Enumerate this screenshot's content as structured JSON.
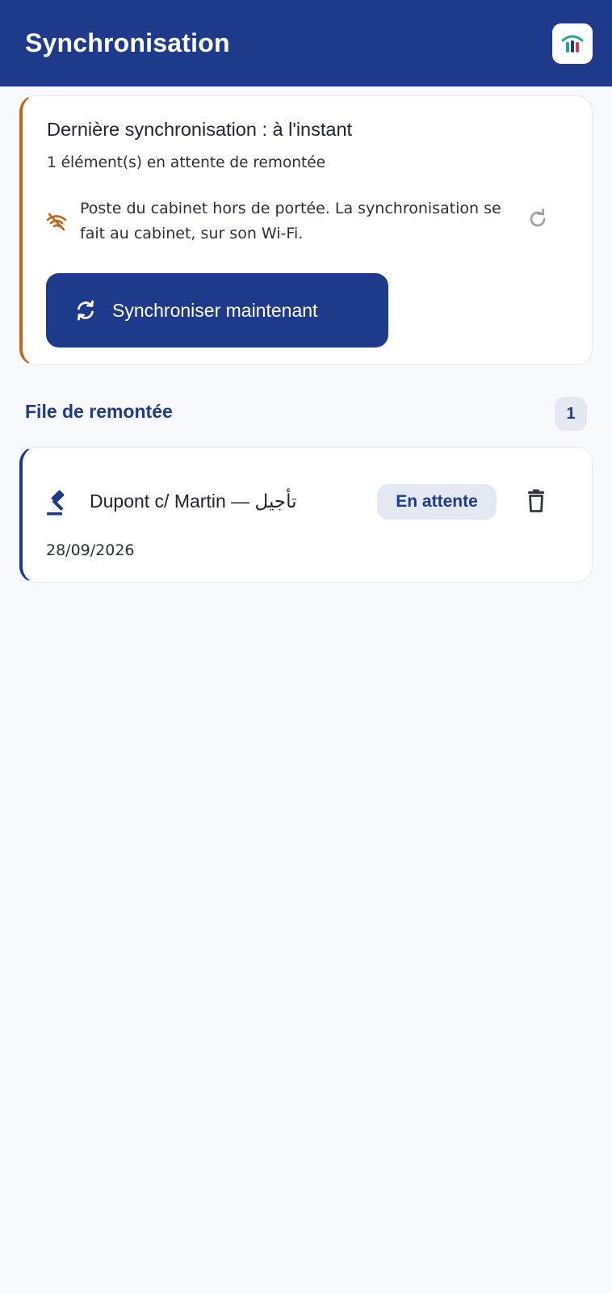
{
  "app_bar": {
    "title": "Synchronisation",
    "logo_icon": "chart-bars-logo-icon"
  },
  "sync_card": {
    "last_sync": "Dernière synchronisation : à l'instant",
    "pending": "1 élément(s) en attente de remontée",
    "offline_icon": "wifi-off-icon",
    "offline_message": "Poste du cabinet hors de portée. La synchronisation se fait au cabinet, sur son Wi-Fi.",
    "refresh_icon": "refresh-icon",
    "sync_button_label": "Synchroniser maintenant",
    "sync_button_icon": "sync-icon",
    "accent_color": "#c0651c"
  },
  "queue": {
    "title": "File de remontée",
    "count": "1",
    "items": [
      {
        "icon": "gavel-icon",
        "title": "تأجيل — Dupont c/ Martin",
        "status": "En attente",
        "date": "28/09/2026",
        "delete_icon": "trash-icon"
      }
    ]
  },
  "colors": {
    "primary": "#1f3a8a",
    "background": "#f7f9fc",
    "warning": "#c0651c",
    "badge_bg": "#e3e8f2"
  }
}
